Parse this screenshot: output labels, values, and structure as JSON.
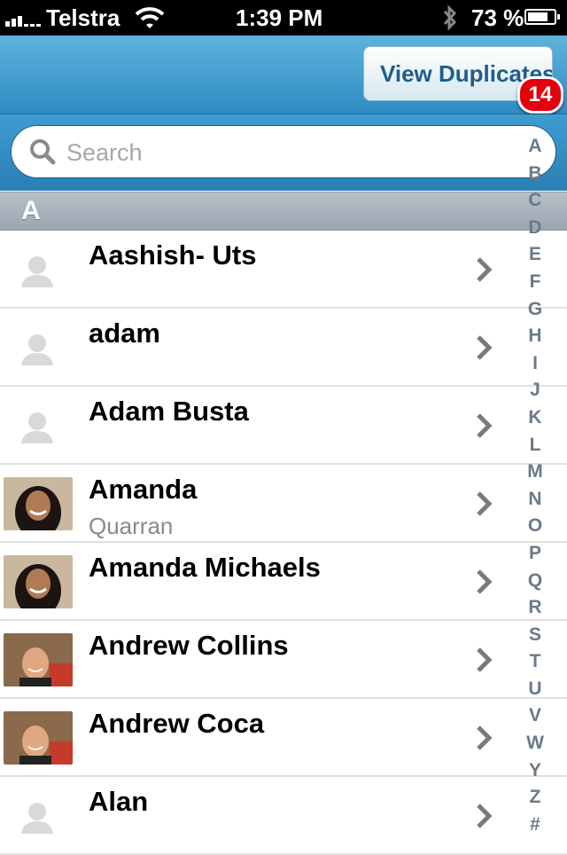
{
  "status_bar": {
    "carrier": "Telstra",
    "time": "1:39 PM",
    "battery_percent": "73 %",
    "icons": [
      "signal-bars-icon",
      "wifi-icon",
      "bluetooth-icon",
      "battery-icon"
    ]
  },
  "nav": {
    "view_duplicates_label": "View Duplicates",
    "duplicates_badge": "14"
  },
  "search": {
    "placeholder": "Search",
    "value": ""
  },
  "section_header": "A",
  "contacts": [
    {
      "name": "Aashish- Uts",
      "subtitle": "",
      "avatar": "generic-person-icon"
    },
    {
      "name": "adam",
      "subtitle": "",
      "avatar": "generic-person-icon"
    },
    {
      "name": "Adam Busta",
      "subtitle": "",
      "avatar": "generic-person-icon"
    },
    {
      "name": "Amanda",
      "subtitle": "Quarran",
      "avatar": "photo"
    },
    {
      "name": "Amanda Michaels",
      "subtitle": "",
      "avatar": "photo"
    },
    {
      "name": "Andrew Collins",
      "subtitle": "",
      "avatar": "photo"
    },
    {
      "name": "Andrew Coca",
      "subtitle": "",
      "avatar": "photo"
    },
    {
      "name": "Alan",
      "subtitle": "",
      "avatar": "generic-person-icon"
    }
  ],
  "index_letters": [
    "A",
    "B",
    "C",
    "D",
    "E",
    "F",
    "G",
    "H",
    "I",
    "J",
    "K",
    "L",
    "M",
    "N",
    "O",
    "P",
    "Q",
    "R",
    "S",
    "T",
    "U",
    "V",
    "W",
    "Y",
    "Z",
    "#"
  ],
  "colors": {
    "nav_blue": "#2e8cc4",
    "badge_red": "#e4000f",
    "index_text": "#6b7a88"
  }
}
